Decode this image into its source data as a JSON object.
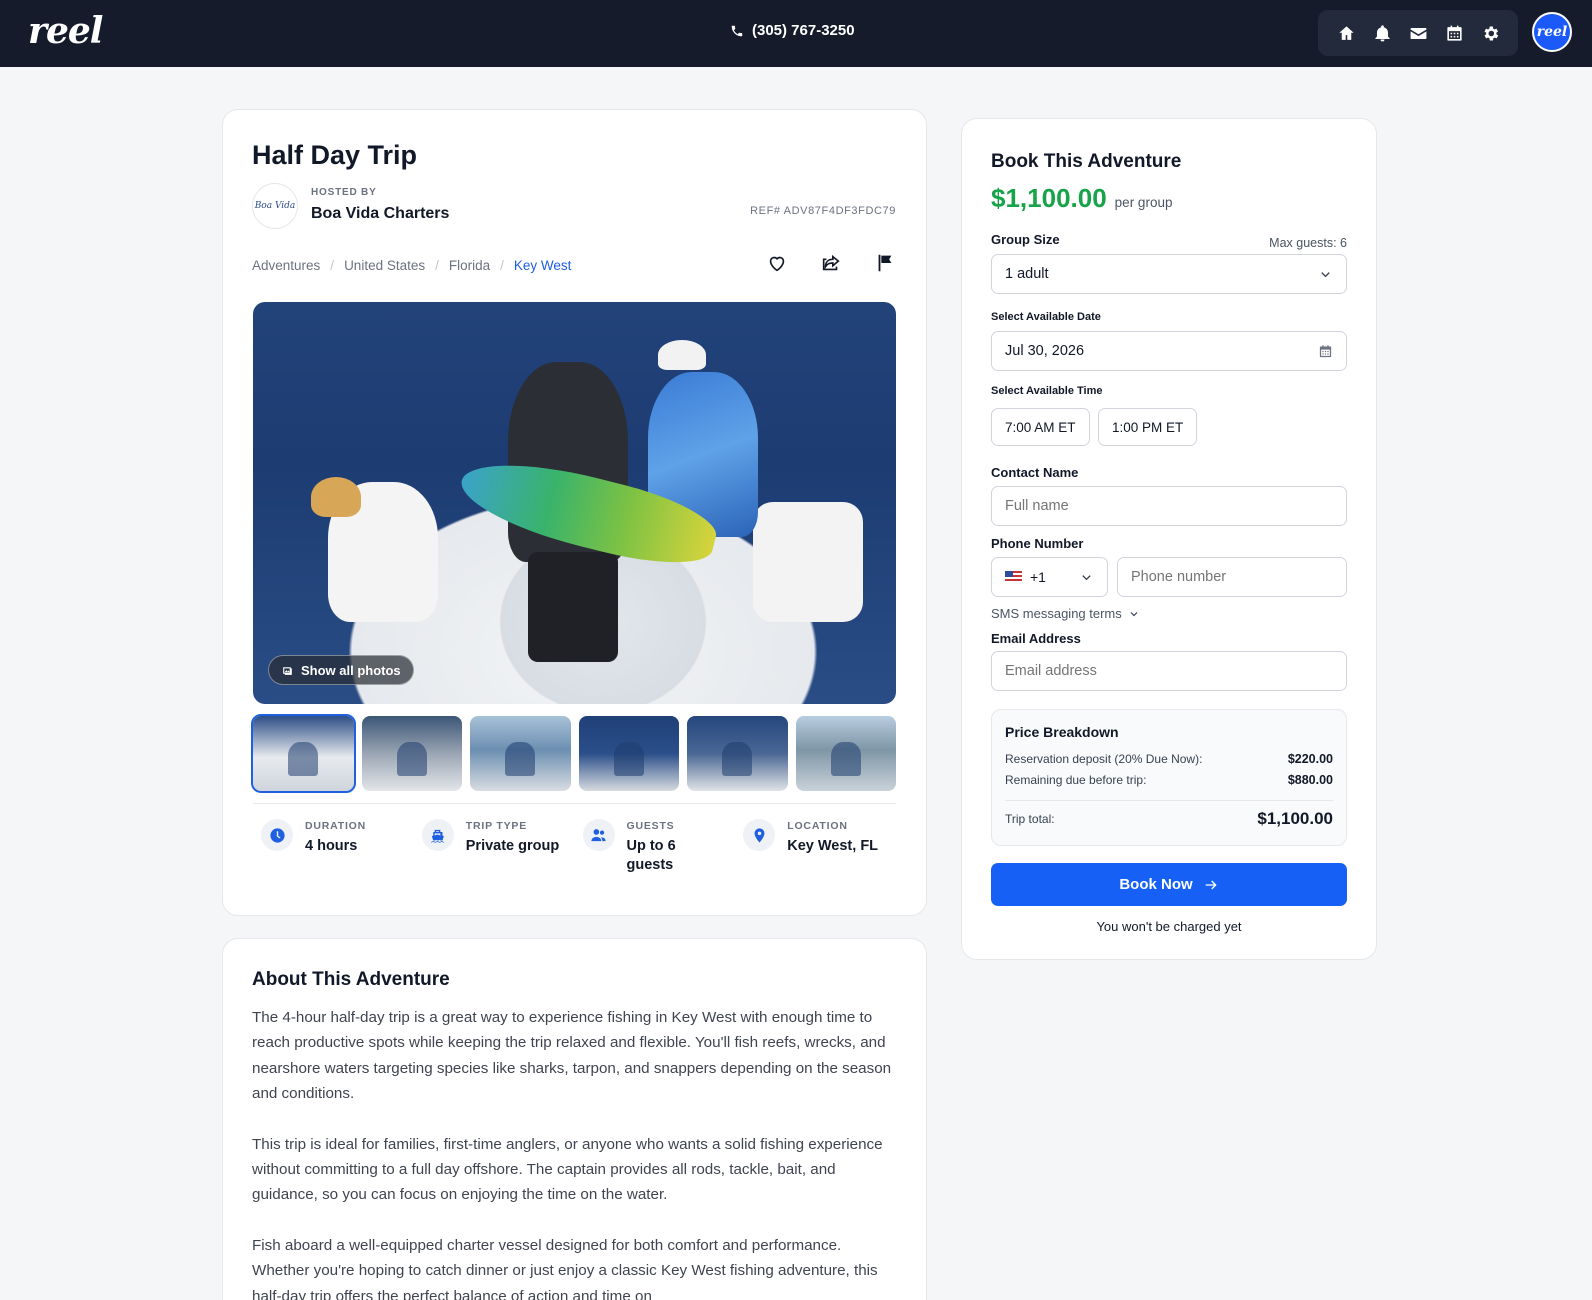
{
  "header": {
    "logo": "reel",
    "phone": "(305) 767-3250",
    "nav": [
      "home-icon",
      "bell-icon",
      "mail-icon",
      "calendar-icon",
      "gear-icon"
    ],
    "avatar": "reel"
  },
  "trip": {
    "title": "Half Day Trip",
    "host_label": "HOSTED BY",
    "host_name": "Boa Vida Charters",
    "host_logo_text": "Boa Vida",
    "ref": "REF# ADV87F4DF3FDC79",
    "breadcrumb": [
      "Adventures",
      "United States",
      "Florida",
      "Key West"
    ],
    "show_photos": "Show all photos",
    "thumbnail_count": 6,
    "stats": [
      {
        "icon": "clock-icon",
        "label": "DURATION",
        "value": "4 hours"
      },
      {
        "icon": "boat-icon",
        "label": "TRIP TYPE",
        "value": "Private group"
      },
      {
        "icon": "users-icon",
        "label": "GUESTS",
        "value": "Up to 6 guests"
      },
      {
        "icon": "map-pin-icon",
        "label": "LOCATION",
        "value": "Key West, FL"
      }
    ]
  },
  "about": {
    "title": "About This Adventure",
    "paragraphs": [
      "The 4-hour half-day trip is a great way to experience fishing in Key West with enough time to reach productive spots while keeping the trip relaxed and flexible. You'll fish reefs, wrecks, and nearshore waters targeting species like sharks, tarpon, and snappers depending on the season and conditions.",
      "This trip is ideal for families, first-time anglers, or anyone who wants a solid fishing experience without committing to a full day offshore. The captain provides all rods, tackle, bait, and guidance, so you can focus on enjoying the time on the water.",
      "Fish aboard a well-equipped charter vessel designed for both comfort and performance. Whether you're hoping to catch dinner or just enjoy a classic Key West fishing adventure, this half-day trip offers the perfect balance of action and time on"
    ]
  },
  "booking": {
    "title": "Book This Adventure",
    "price": "$1,100.00",
    "price_unit": "per group",
    "group_size_label": "Group Size",
    "max_guests": "Max guests: 6",
    "group_size_value": "1 adult",
    "date_label": "Select Available Date",
    "date_value": "Jul 30, 2026",
    "time_label": "Select Available Time",
    "times": [
      "7:00 AM ET",
      "1:00 PM ET"
    ],
    "contact_label": "Contact Name",
    "contact_placeholder": "Full name",
    "phone_label": "Phone Number",
    "country_code": "+1",
    "phone_placeholder": "Phone number",
    "sms_terms": "SMS messaging terms",
    "email_label": "Email Address",
    "email_placeholder": "Email address",
    "breakdown": {
      "title": "Price Breakdown",
      "deposit_label": "Reservation deposit (20% Due Now):",
      "deposit_value": "$220.00",
      "remaining_label": "Remaining due before trip:",
      "remaining_value": "$880.00",
      "total_label": "Trip total:",
      "total_value": "$1,100.00"
    },
    "book_button": "Book Now",
    "note": "You won't be charged yet"
  },
  "colors": {
    "topbar": "#161b2c",
    "accent": "#1660f5",
    "price": "#16a34a"
  }
}
